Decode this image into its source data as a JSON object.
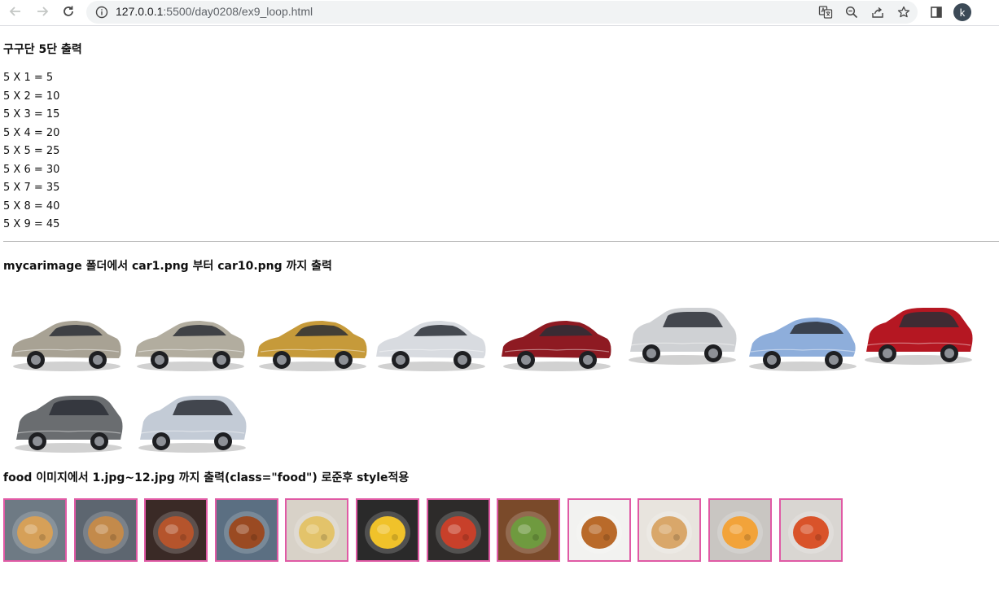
{
  "browser": {
    "url_host": "127.0.0.1",
    "url_path": ":5500/day0208/ex9_loop.html",
    "profile_initial": "k"
  },
  "gugudan": {
    "title": "구구단 5단 출력",
    "lines": [
      "5 X 1 = 5",
      "5 X 2 = 10",
      "5 X 3 = 15",
      "5 X 4 = 20",
      "5 X 5 = 25",
      "5 X 6 = 30",
      "5 X 7 = 35",
      "5 X 8 = 40",
      "5 X 9 = 45"
    ]
  },
  "cars": {
    "title": "mycarimage 폴더에서 car1.png 부터 car10.png 까지 출력",
    "items": [
      {
        "kind": "sedan",
        "color": "#a8a294"
      },
      {
        "kind": "sedan",
        "color": "#b2ad9f"
      },
      {
        "kind": "sedan",
        "color": "#c69a3a"
      },
      {
        "kind": "sedan",
        "color": "#d8dbe0"
      },
      {
        "kind": "sedan",
        "color": "#8e1a22"
      },
      {
        "kind": "suv",
        "color": "#cfd1d4"
      },
      {
        "kind": "hatch",
        "color": "#8eaedb"
      },
      {
        "kind": "suv",
        "color": "#b51722"
      },
      {
        "kind": "suv",
        "color": "#6a6d70"
      },
      {
        "kind": "suv",
        "color": "#c3cbd6"
      }
    ]
  },
  "foods": {
    "title": "food 이미지에서 1.jpg~12.jpg 까지 출력(class=\"food\") 로준후 style적용",
    "border_color": "#e05aa5",
    "items": [
      {
        "bg": "#6e7a84",
        "accent": "#d6a058"
      },
      {
        "bg": "#5d6670",
        "accent": "#c38a4b"
      },
      {
        "bg": "#3a2a26",
        "accent": "#b5542c"
      },
      {
        "bg": "#5b6f82",
        "accent": "#9a4a22"
      },
      {
        "bg": "#d8d2c8",
        "accent": "#e3c36a"
      },
      {
        "bg": "#2a2a2a",
        "accent": "#f0c22a"
      },
      {
        "bg": "#2d2b2a",
        "accent": "#c8402a"
      },
      {
        "bg": "#7a4a2a",
        "accent": "#6f9a3f"
      },
      {
        "bg": "#f2f2f0",
        "accent": "#b96a2a"
      },
      {
        "bg": "#e8e4de",
        "accent": "#d9a76a"
      },
      {
        "bg": "#c9c6c2",
        "accent": "#f2a33a"
      },
      {
        "bg": "#d9d6d2",
        "accent": "#d9532a"
      }
    ]
  }
}
